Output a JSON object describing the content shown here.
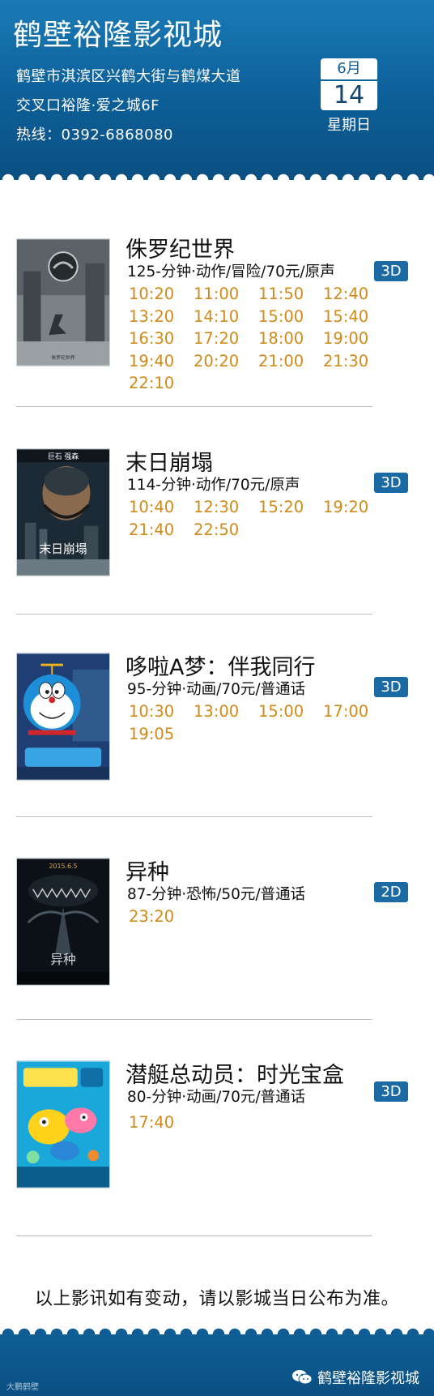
{
  "header": {
    "title": "鹤壁裕隆影视城",
    "address_line1": "鹤壁市淇滨区兴鹤大街与鹤煤大道",
    "address_line2": "交叉口裕隆·爱之城6F",
    "hotline": "热线：0392-6868080",
    "date": {
      "month": "6月",
      "day": "14",
      "weekday": "星期日"
    }
  },
  "movies": [
    {
      "title": "侏罗纪世界",
      "info": "125-分钟·动作/冒险/70元/原声",
      "format": "3D",
      "poster_icon": "dinosaur-poster",
      "poster_text": "侏罗纪世界",
      "times": [
        "10:20",
        "11:00",
        "11:50",
        "12:40",
        "13:20",
        "14:10",
        "15:00",
        "15:40",
        "16:30",
        "17:20",
        "18:00",
        "19:00",
        "19:40",
        "20:20",
        "21:00",
        "21:30",
        "22:10"
      ]
    },
    {
      "title": "末日崩塌",
      "info": "114-分钟·动作/70元/原声",
      "format": "3D",
      "poster_icon": "disaster-poster",
      "poster_text": "末日崩塌",
      "poster_top": "巨石 强森",
      "times": [
        "10:40",
        "12:30",
        "15:20",
        "19:20",
        "21:40",
        "22:50"
      ]
    },
    {
      "title": "哆啦A梦：伴我同行",
      "info": "95-分钟·动画/70元/普通话",
      "format": "3D",
      "poster_icon": "doraemon-poster",
      "times": [
        "10:30",
        "13:00",
        "15:00",
        "17:00",
        "19:05"
      ]
    },
    {
      "title": "异种",
      "info": "87-分钟·恐怖/50元/普通话",
      "format": "2D",
      "poster_icon": "horror-poster",
      "poster_text": "异种",
      "poster_top": "2015.6.5",
      "times": [
        "23:20"
      ]
    },
    {
      "title": "潜艇总动员：时光宝盒",
      "info": "80-分钟·动画/70元/普通话",
      "format": "3D",
      "poster_icon": "submarine-poster",
      "times": [
        "17:40"
      ]
    }
  ],
  "notice": "以上影讯如有变动，请以影城当日公布为准。",
  "footer": {
    "brand": "鹤壁裕隆影视城",
    "watermark": "大鹏鹤壁"
  }
}
